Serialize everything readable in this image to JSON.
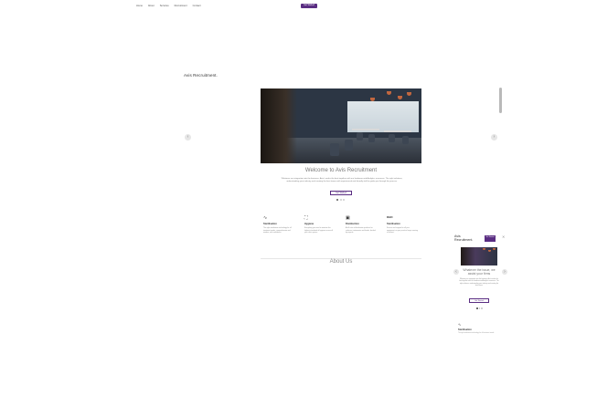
{
  "desktop": {
    "logo": "Avis Recruitment.",
    "nav": [
      "Home",
      "About",
      "Services",
      "Recruitment",
      "Contact"
    ],
    "cta_label": "Get Started",
    "prev_arrow": "‹",
    "next_arrow": "›",
    "hero": {
      "title": "Welcome to Avis Recruitment",
      "intro": "Whatever our integration into the business, Avis's works the best together with our hardware and Analytics resources. The right solutions, understanding your industry and creating the best teams with experienced and friendly staff to guide you through the process.",
      "button": "Get Started"
    },
    "features": [
      {
        "icon": "activity-icon",
        "glyph": "∿",
        "title": "Sterilisation",
        "desc": "The right sterilisation technology for all treatment needs; comprehensive and modern, with confidence."
      },
      {
        "icon": "frame-icon",
        "glyph": "⛶",
        "title": "Hygiene",
        "desc": "Everything you need to maintain the highest standards of hygiene across all your clinic spaces."
      },
      {
        "icon": "calendar-icon",
        "glyph": "▣",
        "title": "Disinfection",
        "desc": "A full suite of disinfection products for surfaces, instruments and hands, backed by experts."
      },
      {
        "icon": "dhd-icon",
        "glyph": "DHD",
        "title": "Sterilisation",
        "desc": "Service and support for all your equipment, so your practice keeps running at its best."
      }
    ],
    "about_title": "About Us"
  },
  "mobile": {
    "logo": "Avis Recruitment.",
    "cta_label": "Get Started",
    "close": "✕",
    "hero_title": "Whatever the issue, we assist your firms",
    "intro": "Whatever our integration into the business, Avis's works the best together with our hardware and Analytics resources. The right solutions, understanding your industry and creating the best teams.",
    "button": "Get Started",
    "feature_icon": "∿",
    "feature_title": "Sterilisation",
    "feature_desc": "The right sterilisation technology for all treatment needs."
  },
  "colors": {
    "accent": "#5a2d82",
    "text": "#333333",
    "muted": "#888888"
  }
}
